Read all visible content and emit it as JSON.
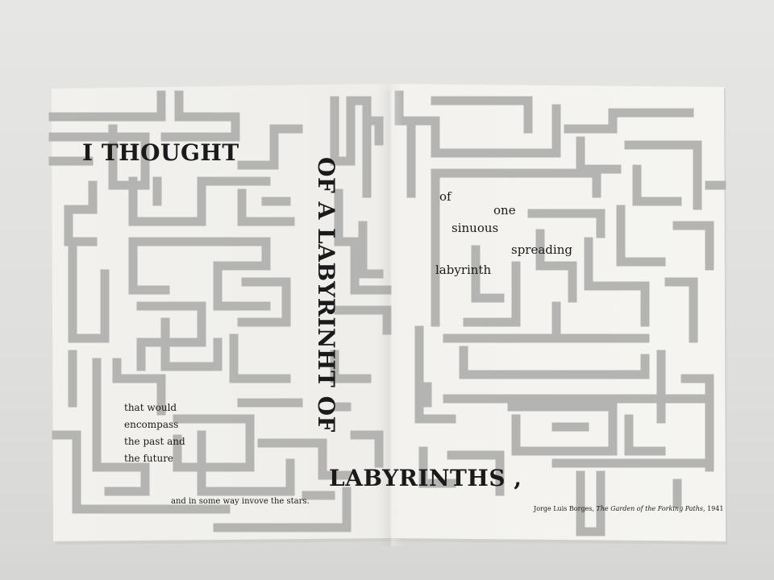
{
  "poem": {
    "line_thought": "I THOUGHT",
    "line_vertical": "OF A LABYRINHT OF",
    "line_labyrinths": "LABYRINTHS",
    "comma": ",",
    "word_of": "of",
    "word_one": "one",
    "word_sinuous": "sinuous",
    "word_spreading": "spreading",
    "word_labyrinth": "labyrinth",
    "block_lines": [
      "that would",
      "encompass",
      "the past and",
      "the future"
    ],
    "line_stars": "and in some way invove the stars."
  },
  "attribution": {
    "author": "Jorge Luis Borges, ",
    "title": "The Garden of the Forking Paths",
    "year": ", 1941"
  },
  "colors": {
    "background": "#e2e2e0",
    "paper": "#f4f3ef",
    "maze": "#b3b3b1",
    "ink": "#1a1a1a"
  }
}
